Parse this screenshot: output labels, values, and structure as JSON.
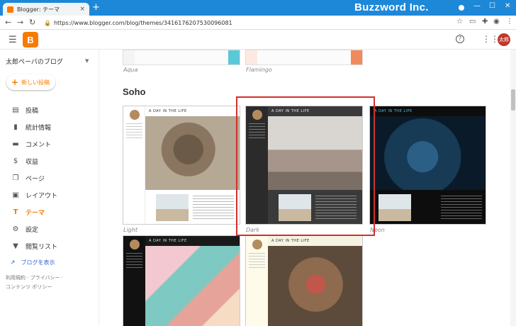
{
  "browser": {
    "tab_title": "Blogger: テーマ",
    "tab_close": "×",
    "new_tab": "+",
    "url": "https://www.blogger.com/blog/themes/3416176207530096081",
    "brand_watermark": "Buzzword Inc.",
    "window_controls": [
      "—",
      "☐",
      "✕"
    ]
  },
  "header": {
    "logo_letter": "B",
    "avatar_text": "太郎"
  },
  "sidebar": {
    "blog_name": "太郎ペーパのブログ",
    "new_post": "新しい投稿",
    "items": [
      {
        "label": "投稿",
        "icon": "posts-icon"
      },
      {
        "label": "統計情報",
        "icon": "stats-icon"
      },
      {
        "label": "コメント",
        "icon": "comment-icon"
      },
      {
        "label": "収益",
        "icon": "dollar-icon"
      },
      {
        "label": "ページ",
        "icon": "pages-icon"
      },
      {
        "label": "レイアウト",
        "icon": "layout-icon"
      },
      {
        "label": "テーマ",
        "icon": "theme-icon",
        "active": true
      },
      {
        "label": "設定",
        "icon": "gear-icon"
      },
      {
        "label": "閲覧リスト",
        "icon": "bookmark-icon"
      }
    ],
    "view_blog": "ブログを表示",
    "legal_line1": "利用規約 · プライバシー ·",
    "legal_line2": "コンテンツ ポリシー"
  },
  "main": {
    "top_captions": [
      "Aqua",
      "Flamingo"
    ],
    "section_title": "Soho",
    "cards": [
      {
        "caption": "Light",
        "header": "A DAY IN THE LIFE"
      },
      {
        "caption": "Dark",
        "header": "A DAY IN THE LIFE"
      },
      {
        "caption": "Neon",
        "header": "A DAY IN THE LIFE"
      },
      {
        "caption": "",
        "header": "A DAY IN THE LIFE"
      },
      {
        "caption": "",
        "header": "A DAY IN THE LIFE"
      }
    ]
  },
  "colors": {
    "chrome_blue": "#1e88d8",
    "blogger_orange": "#f57c00",
    "selection_red": "#d32f2f"
  }
}
